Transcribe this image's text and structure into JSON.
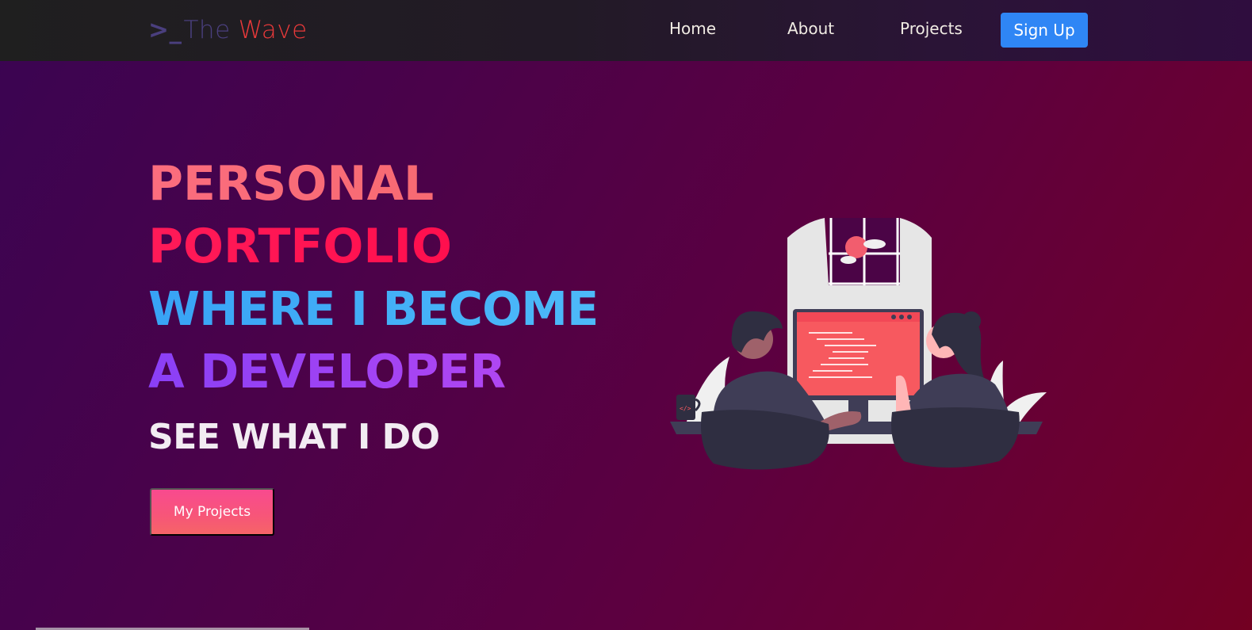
{
  "navbar": {
    "brand": {
      "prompt": ">_",
      "the": "The",
      "wave": "Wave"
    },
    "links": [
      {
        "label": "Home"
      },
      {
        "label": "About"
      },
      {
        "label": "Projects"
      }
    ],
    "signup_label": "Sign Up"
  },
  "hero": {
    "line1": "PERSONAL",
    "line2": "PORTFOLIO",
    "line3": "WHERE I BECOME",
    "line4": "A DEVELOPER",
    "subhead": "SEE WHAT I DO",
    "cta_label": "My Projects"
  },
  "colors": {
    "brand_accent": "#e8393a",
    "brand_muted": "#4a3f7e",
    "signup_bg": "#2f86f5",
    "line1": "#fb6d7e",
    "line2": "#ff1a58",
    "line3": "#38a3f5",
    "line4": "#9b44f5",
    "cta_bg": "#f84a8f"
  },
  "illustration": {
    "icon": "developers-at-computer-illustration"
  }
}
